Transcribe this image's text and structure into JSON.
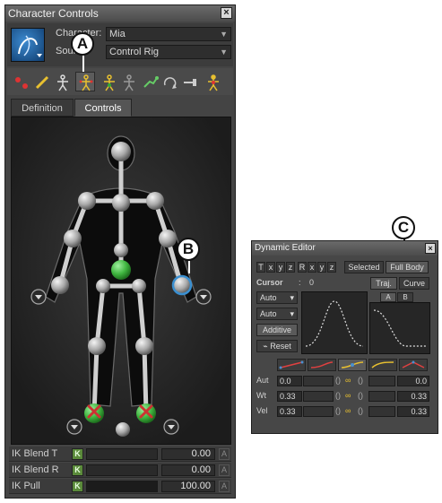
{
  "character_controls": {
    "title": "Character Controls",
    "close_glyph": "×",
    "character_label": "Character:",
    "character_value": "Mia",
    "source_label": "Source:",
    "source_value": "Control Rig",
    "tabs": [
      {
        "label": "Definition",
        "active": false
      },
      {
        "label": "Controls",
        "active": true
      }
    ],
    "toolbar_icons": [
      "nodes-icon",
      "pencil-icon",
      "stick-figure-icon",
      "full-body-ik-icon",
      "body-part-ik-icon",
      "translation-icon",
      "rotation-icon",
      "pin-icon",
      "pose-icon"
    ],
    "sliders": [
      {
        "label": "IK Blend T",
        "key": "K",
        "value": "0.00",
        "fraction": 0.0
      },
      {
        "label": "IK Blend R",
        "key": "K",
        "value": "0.00",
        "fraction": 0.0
      },
      {
        "label": "IK Pull",
        "key": "K",
        "value": "100.00",
        "fraction": 1.0
      }
    ],
    "anim_box": "A"
  },
  "callouts": {
    "a": "A",
    "b": "B",
    "c": "C"
  },
  "dynamic_editor": {
    "title": "Dynamic Editor",
    "close_glyph": "×",
    "axis_buttons": [
      "T",
      "x",
      "y",
      "z",
      "R",
      "x",
      "y",
      "z"
    ],
    "selected_label": "Selected",
    "full_body_label": "Full Body",
    "cursor_label": "Cursor",
    "cursor_value": "0",
    "traj_label": "Traj.",
    "curve_label": "Curve",
    "curve_a": "A",
    "curve_b": "B",
    "auto1": "Auto",
    "auto2": "Auto",
    "additive_label": "Additive",
    "reset_label": "Reset",
    "rows": [
      {
        "label": "Aut",
        "left": "0.0",
        "right": "0.0"
      },
      {
        "label": "Wt",
        "left": "0.33",
        "right": "0.33"
      },
      {
        "label": "Vel",
        "left": "0.33",
        "right": "0.33"
      }
    ]
  },
  "colors": {
    "hip_green": "#3fb53f",
    "selected_effector": "#3a8fd0",
    "pin_red": "#cc3333"
  }
}
